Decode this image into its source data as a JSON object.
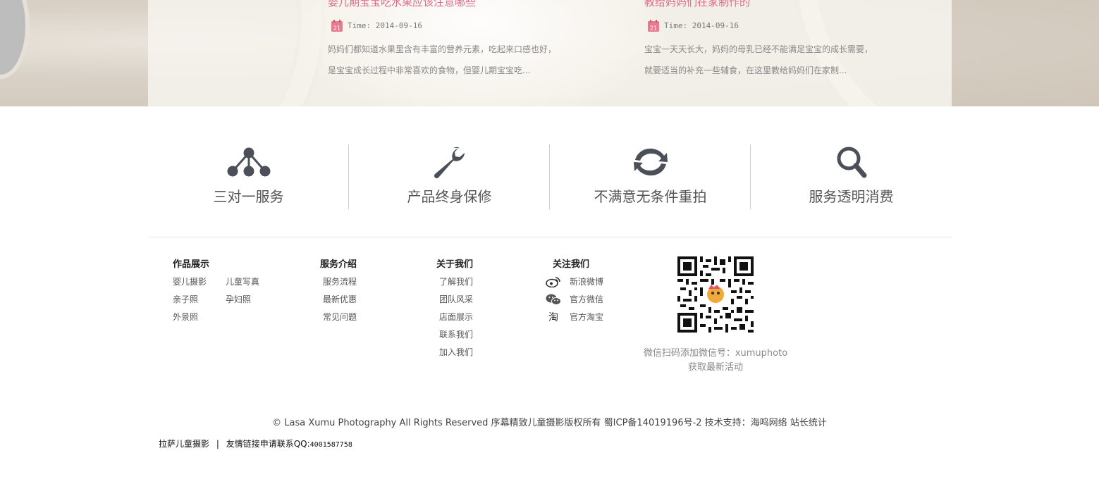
{
  "news": [
    {
      "title": "婴儿期宝宝吃水果应该注意哪些",
      "date_badge": "21",
      "time": "Time: 2014-09-16",
      "desc_line1": "妈妈们都知道水果里含有丰富的营养元素，吃起来口感也好，",
      "desc_line2": "是宝宝成长过程中非常喜欢的食物，但婴儿期宝宝吃..."
    },
    {
      "title": "教给妈妈们在家制作的",
      "date_badge": "21",
      "time": "Time: 2014-09-16",
      "desc_line1": "宝宝一天天长大，妈妈的母乳已经不能满足宝宝的成长需要，",
      "desc_line2": "就要适当的补充一些辅食，在这里教给妈妈们在家制..."
    }
  ],
  "features": [
    {
      "label": "三对一服务",
      "icon": "network-icon"
    },
    {
      "label": "产品终身保修",
      "icon": "wrench-icon"
    },
    {
      "label": "不满意无条件重拍",
      "icon": "refresh-icon"
    },
    {
      "label": "服务透明消费",
      "icon": "search-icon"
    }
  ],
  "footer": {
    "works": {
      "heading": "作品展示",
      "items": [
        "婴儿摄影",
        "儿童写真",
        "亲子照",
        "孕妇照",
        "外景照"
      ]
    },
    "service": {
      "heading": "服务介绍",
      "items": [
        "服务流程",
        "最新优惠",
        "常见问题"
      ]
    },
    "about": {
      "heading": "关于我们",
      "items": [
        "了解我们",
        "团队风采",
        "店面展示",
        "联系我们",
        "加入我们"
      ]
    },
    "follow": {
      "heading": "关注我们",
      "items": [
        {
          "label": "新浪微博",
          "icon": "weibo-icon"
        },
        {
          "label": "官方微信",
          "icon": "wechat-icon"
        },
        {
          "label": "官方淘宝",
          "icon": "taobao-icon"
        }
      ]
    },
    "qr_caption_line1": "微信扫码添加微信号：xumuphoto",
    "qr_caption_line2": "获取最新活动"
  },
  "copyright": "© Lasa Xumu Photography All Rights Reserved 序幕精致儿童摄影版权所有 蜀ICP备14019196号-2 技术支持：海鸣网络 站长统计",
  "friend_links": {
    "site": "拉萨儿童摄影",
    "divider": "|",
    "apply": "友情链接申请联系QQ:",
    "qq": "4001587758"
  },
  "colors": {
    "accent": "#e06a8a",
    "icon": "#4a4f58"
  }
}
